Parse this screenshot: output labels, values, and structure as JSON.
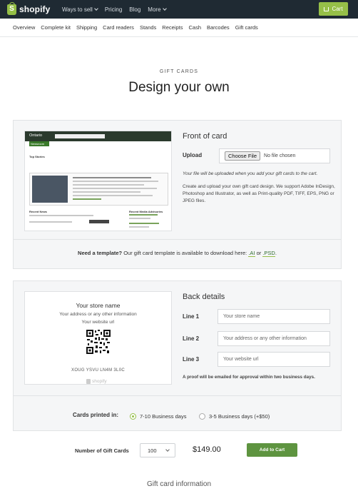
{
  "header": {
    "logo_text": "shopify",
    "nav": [
      {
        "label": "Ways to sell",
        "has_dropdown": true
      },
      {
        "label": "Pricing",
        "has_dropdown": false
      },
      {
        "label": "Blog",
        "has_dropdown": false
      },
      {
        "label": "More",
        "has_dropdown": true
      }
    ],
    "cart_label": "Cart",
    "brand_color": "#96bf48",
    "bar_color": "#1f2a33"
  },
  "subnav": [
    "Overview",
    "Complete kit",
    "Shipping",
    "Card readers",
    "Stands",
    "Receipts",
    "Cash",
    "Barcodes",
    "Gift cards"
  ],
  "page": {
    "eyebrow": "GIFT CARDS",
    "title": "Design your own"
  },
  "front": {
    "section_title": "Front of card",
    "upload_label": "Upload",
    "choose_button": "Choose File",
    "file_status": "No file chosen",
    "help_italic": "Your file will be uploaded when you add your gift cards to the cart.",
    "help_text": "Create and upload your own gift card design. We support Adobe InDesign, Photoshop and Illustrator, as well as Print-quality PDF, TIFF, EPS, PNG or JPEG files.",
    "preview": {
      "site_name": "Ontario",
      "tab": "Newsroom",
      "top_stories": "Top Stories",
      "recent_news": "Recent News",
      "recent_media": "Recent Media Advisories"
    }
  },
  "template": {
    "prefix": "Need a template?",
    "text": " Our gift card template is available to download here: ",
    "ai_link": ".AI",
    "or": " or ",
    "psd_link": ".PSD",
    "suffix": "."
  },
  "back": {
    "section_title": "Back details",
    "card": {
      "name": "Your store name",
      "address": "Your address or any other information",
      "url": "Your website url",
      "code": "XOUG YSVU LN4M 3L0C",
      "logo": "shopify"
    },
    "fields": [
      {
        "label": "Line 1",
        "placeholder": "Your store name"
      },
      {
        "label": "Line 2",
        "placeholder": "Your address or any other information"
      },
      {
        "label": "Line 3",
        "placeholder": "Your website url"
      }
    ],
    "proof_note": "A proof will be emailed for approval within two business days."
  },
  "printing": {
    "label": "Cards printed in:",
    "options": [
      {
        "label": "7-10 Business days",
        "selected": true
      },
      {
        "label": "3-5 Business days (+$50)",
        "selected": false
      }
    ]
  },
  "order": {
    "qty_label": "Number of Gift Cards",
    "qty_value": "100",
    "price": "$149.00",
    "add_button": "Add to Cart",
    "button_color": "#5e9440"
  },
  "footer_heading": "Gift card information"
}
